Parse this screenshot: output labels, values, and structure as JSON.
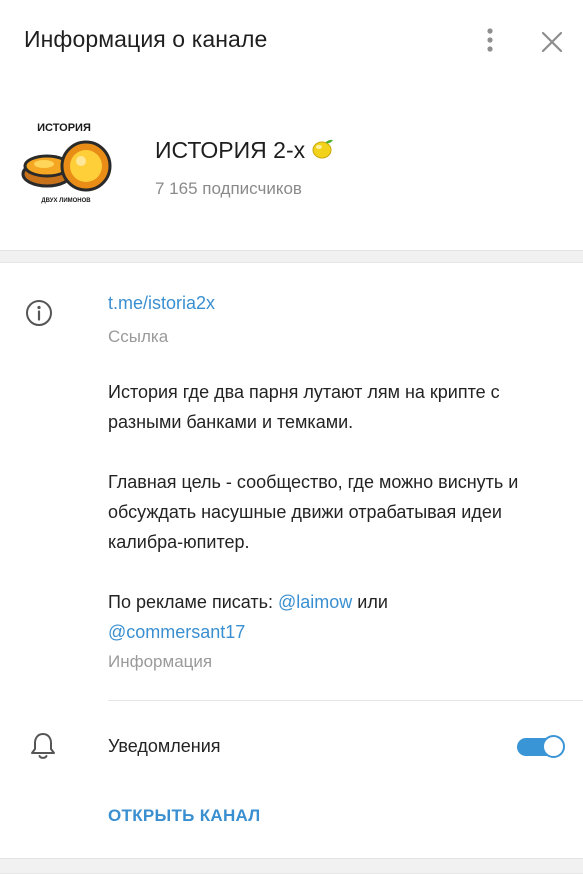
{
  "header": {
    "title": "Информация о канале",
    "menu_icon": "kebab-menu-icon",
    "close_icon": "close-icon"
  },
  "channel": {
    "name": "ИСТОРИЯ 2-х",
    "name_emoji_icon": "lemon-icon",
    "subscribers": "7 165 подписчиков",
    "avatar_logo_text_top": "ИСТОРИЯ",
    "avatar_logo_text_bottom": "ДВУХ ЛИМОНОВ"
  },
  "info": {
    "link": "t.me/istoria2x",
    "link_caption": "Ссылка",
    "description": {
      "p1": "История где два парня лутают лям на крипте с разными банками и темками.",
      "p2": "Главная цель - сообщество, где можно виснуть и обсуждать насушные движи отрабатывая идеи калибра-юпитер.",
      "p3_prefix": "По рекламе писать: ",
      "mention1": "@laimow",
      "p3_middle": " или ",
      "mention2": "@commersant17"
    },
    "description_caption": "Информация"
  },
  "notifications": {
    "label": "Уведомления",
    "enabled": true
  },
  "actions": {
    "open_channel": "ОТКРЫТЬ КАНАЛ"
  },
  "colors": {
    "accent": "#3a8fd0",
    "toggle": "#3a95d6",
    "muted_text": "#9a9a9a",
    "separator": "#f1f1f1"
  }
}
